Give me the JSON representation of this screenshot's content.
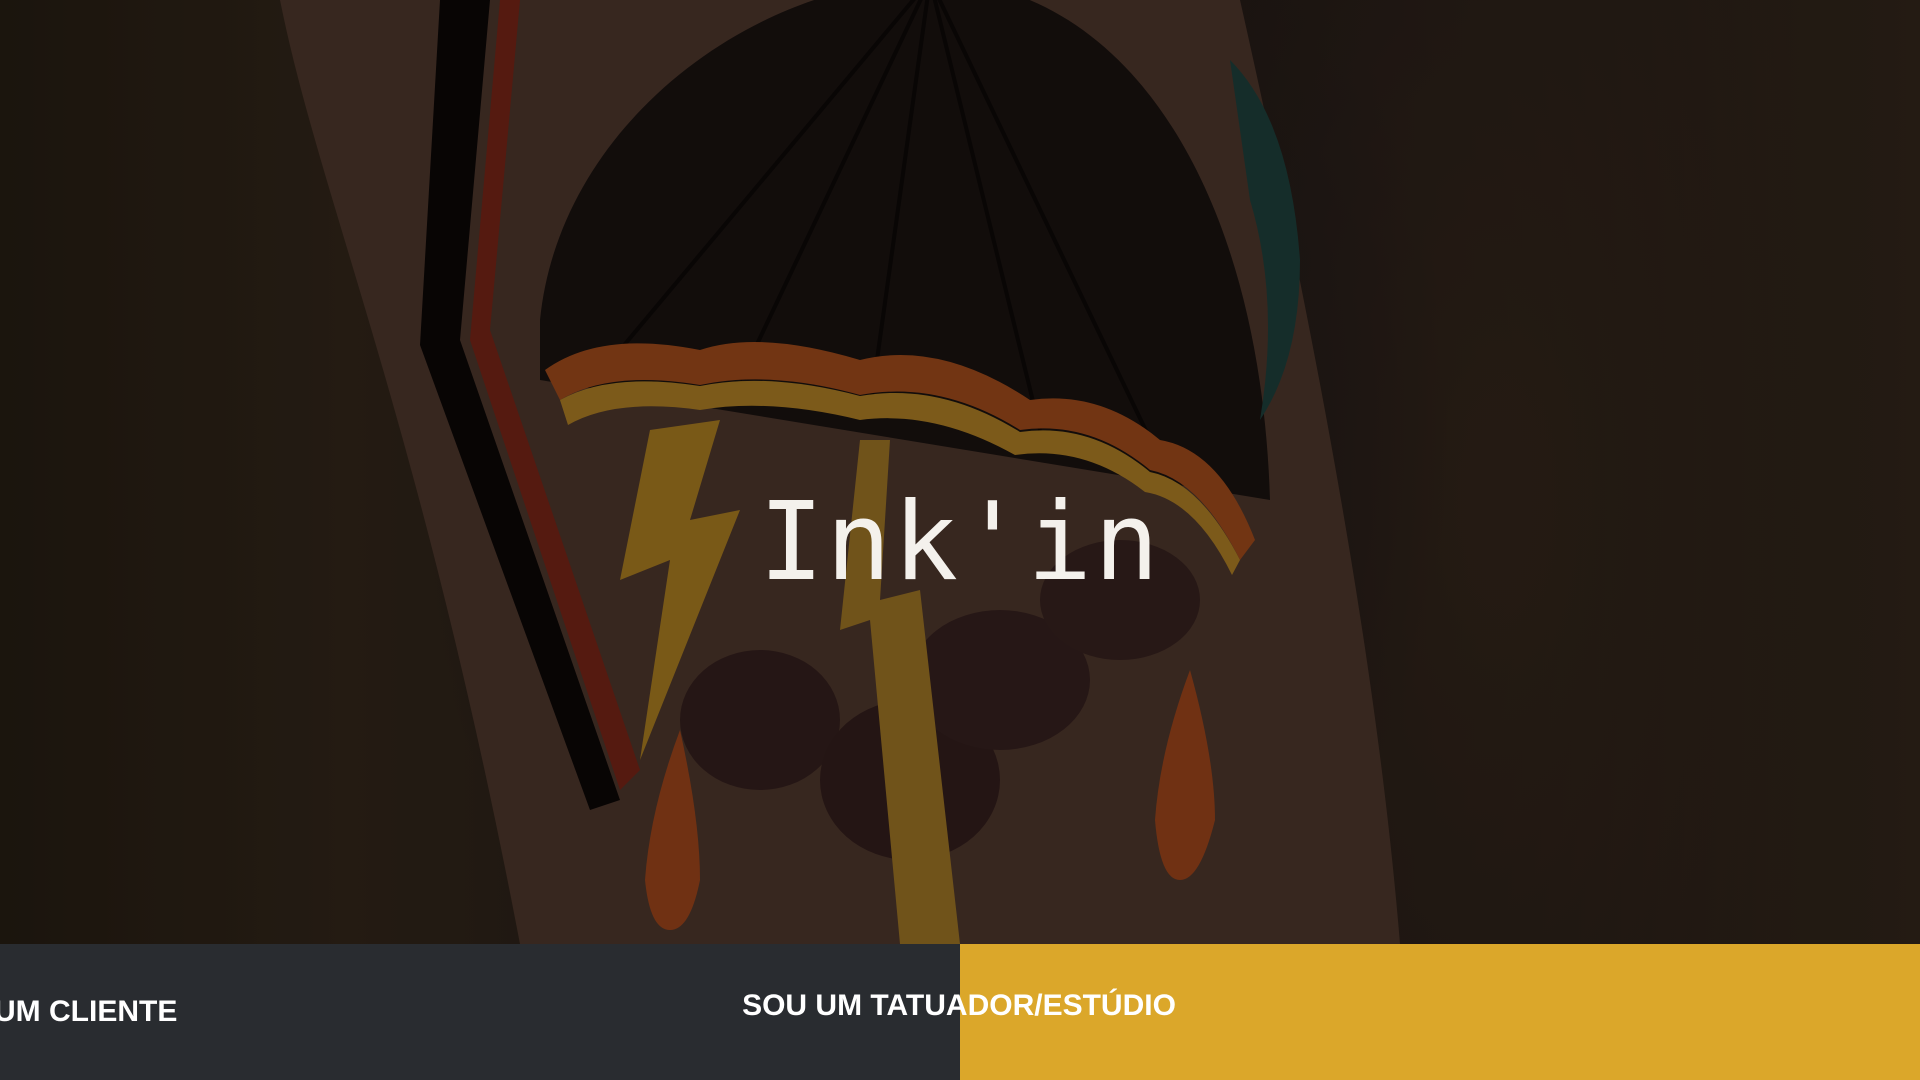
{
  "hero": {
    "image_description_icon": "tattoo-umbrella-photo",
    "brand": "Ink'in"
  },
  "actions": {
    "client_label": "SOU UM CLIENTE",
    "artist_label": "SOU UM TATUADOR/ESTÚDIO"
  },
  "colors": {
    "client_button": "#292c30",
    "artist_button": "#dba72a",
    "text": "#ffffff"
  }
}
